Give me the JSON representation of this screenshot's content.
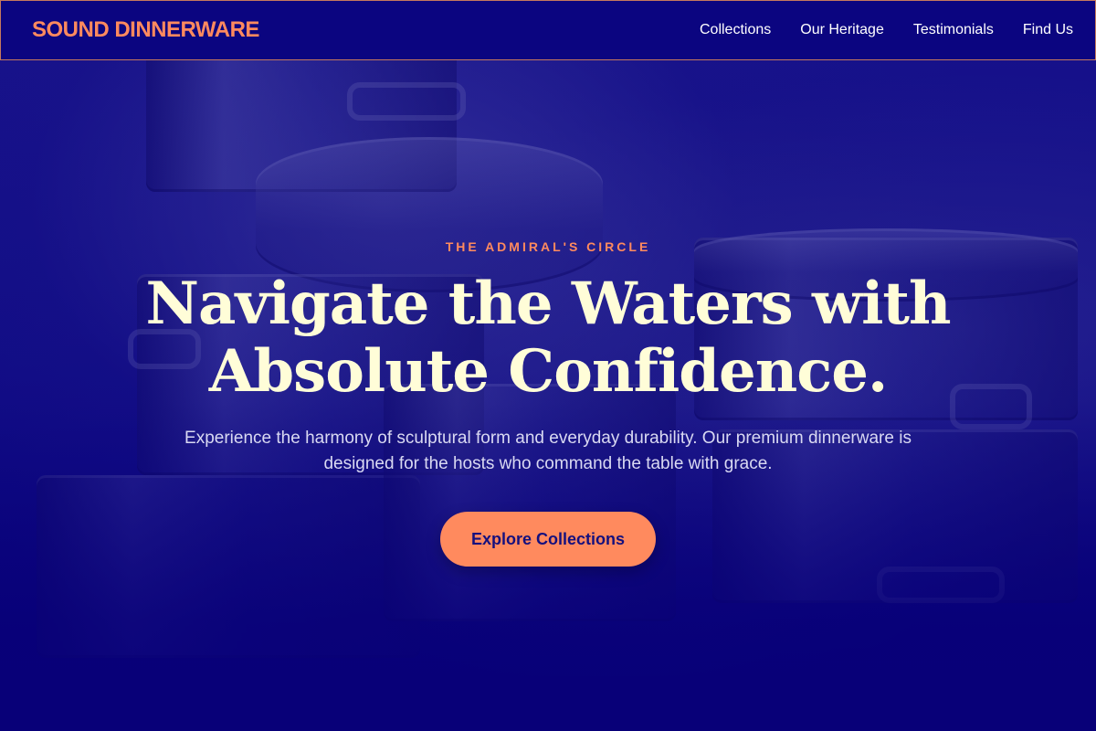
{
  "nav": {
    "brand": "SOUND DINNERWARE",
    "links": [
      "Collections",
      "Our Heritage",
      "Testimonials",
      "Find Us"
    ]
  },
  "hero": {
    "eyebrow": "THE ADMIRAL'S CIRCLE",
    "headline": "Navigate the Waters with Absolute Confidence.",
    "subtext": "Experience the harmony of sculptural form and everyday durability. Our premium dinnerware is designed for the hosts who command the table with grace.",
    "cta_label": "Explore Collections"
  },
  "colors": {
    "background": "#0b0580",
    "accent": "#ff8a5e",
    "headline": "#fffdd8",
    "nav_border": "#c4785e"
  }
}
